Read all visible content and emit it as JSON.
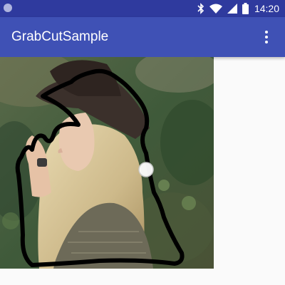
{
  "status_bar": {
    "time": "14:20",
    "icons": [
      "notification-dot-icon",
      "bluetooth-icon",
      "wifi-icon",
      "signal-icon",
      "battery-icon"
    ]
  },
  "app_bar": {
    "title": "GrabCutSample",
    "menu_icon": "overflow-menu-icon"
  },
  "colors": {
    "status_bar": "#2f3a9e",
    "app_bar": "#3f51b5",
    "background": "#fafafa",
    "stroke": "#000000"
  },
  "canvas": {
    "image": "photo of woman with hat",
    "selection_outline": "hand-drawn black outline",
    "touch_indicator": "white circle"
  }
}
